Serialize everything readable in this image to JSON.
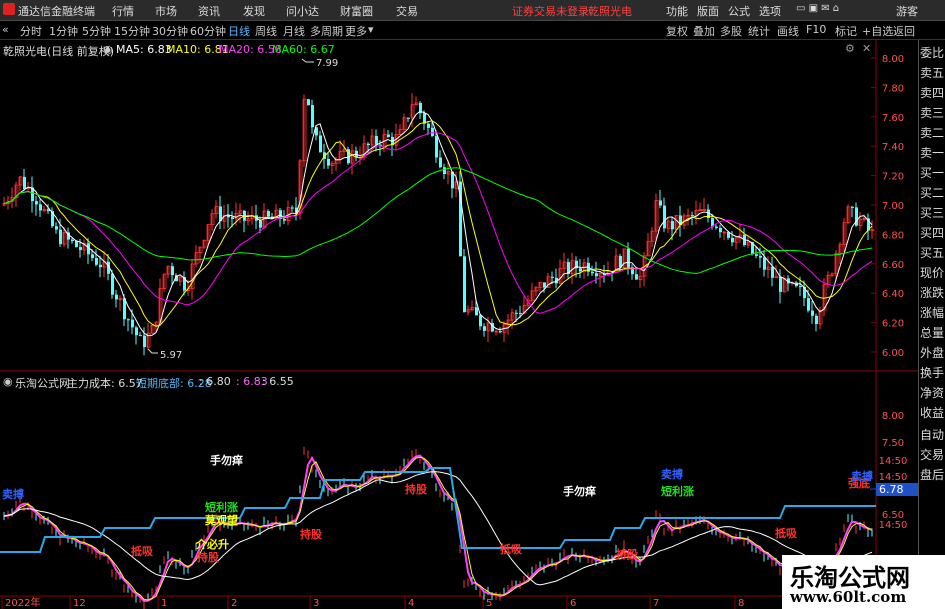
{
  "topbar": {
    "app_title": "通达信金融终端",
    "menu": [
      "行情",
      "市场",
      "资讯",
      "发现",
      "问小达",
      "财富圈",
      "交易"
    ],
    "status": "证券交易未登录",
    "stock_name_top": "乾照光电",
    "right_menu": [
      "功能",
      "版面",
      "公式",
      "选项"
    ],
    "guest": "游客"
  },
  "toolbar": {
    "periods": [
      "分时",
      "1分钟",
      "5分钟",
      "15分钟",
      "30分钟",
      "60分钟",
      "日线",
      "周线",
      "月线",
      "多周期",
      "更多"
    ],
    "active_period": "日线",
    "right_buttons": [
      "复权",
      "叠加",
      "多股",
      "统计",
      "画线",
      "F10",
      "标记",
      "+自选",
      "返回"
    ]
  },
  "main_panel": {
    "title": "乾照光电(日线 前复权)",
    "ma5": "MA5: 6.83",
    "ma10": "MA10: 6.81",
    "ma20": "MA20: 6.58",
    "ma60": "MA60: 6.67",
    "high_marker": "7.99",
    "low_marker": "5.97",
    "price_axis": [
      "8.00",
      "7.80",
      "7.60",
      "7.40",
      "7.20",
      "7.00",
      "6.80",
      "6.60",
      "6.40",
      "6.20",
      "6.00"
    ],
    "colors": {
      "ma5": "#ffffff",
      "ma10": "#ffff00",
      "ma20": "#ff00ff",
      "ma60": "#00ff00",
      "up": "#ff3232",
      "down": "#54ffff"
    }
  },
  "sub_panel": {
    "title": "乐淘公式网",
    "cost_label": "主力成本: 6.57",
    "bottom_label": "短期底部: 6.28",
    "v1": ": 6.80",
    "v2": ": 6.83",
    "v3": ": 6.55",
    "price_axis": [
      "8.00",
      "7.50",
      "14:50",
      "14:50",
      "14:50",
      "6.50",
      "14:50"
    ],
    "current_price": "6.78",
    "annotations": [
      "卖搏",
      "手勿痒",
      "短利涨",
      "莫观望",
      "介必升",
      "抵吸",
      "持股",
      "持股",
      "持股",
      "抵吸",
      "手勿痒",
      "卖搏",
      "短利涨",
      "抵吸",
      "持股",
      "强底",
      "卖搏"
    ]
  },
  "sidebar": [
    "委比",
    "卖五",
    "卖四",
    "卖三",
    "卖二",
    "卖一",
    "买一",
    "买二",
    "买三",
    "买四",
    "买五",
    "现价",
    "涨跌",
    "涨幅",
    "总量",
    "外盘",
    "换手",
    "净资",
    "收益",
    "自动",
    "交易",
    "盘后"
  ],
  "date_axis": [
    "2022年",
    "12",
    "1",
    "2",
    "3",
    "4",
    "5",
    "6",
    "7",
    "8"
  ],
  "watermark": {
    "line1": "乐淘公式网",
    "line2": "www.60lt.com"
  }
}
